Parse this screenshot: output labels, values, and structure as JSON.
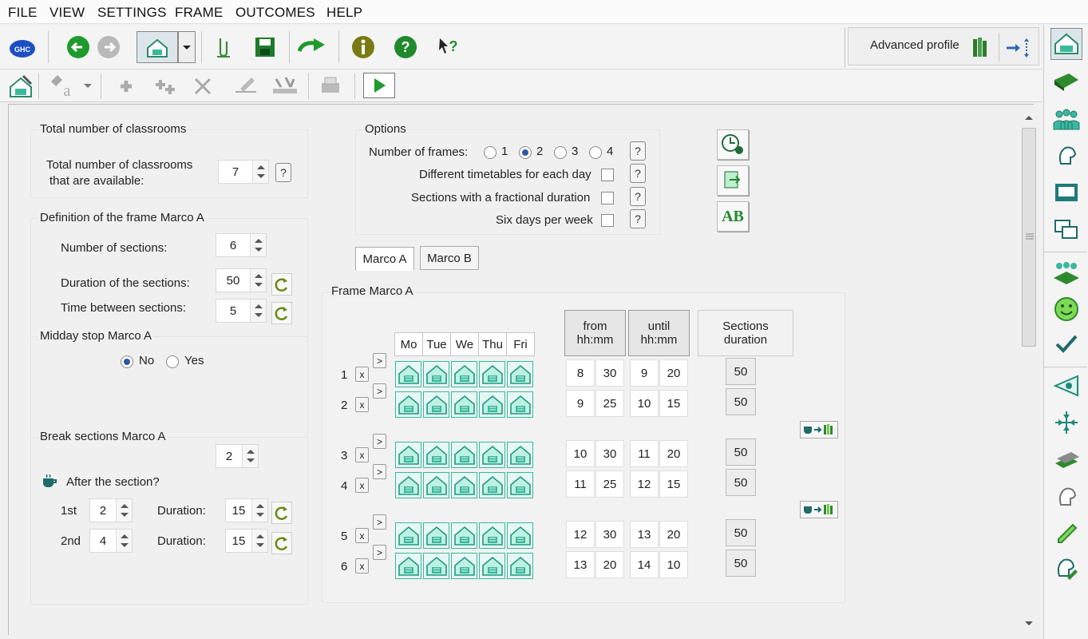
{
  "menu": [
    "FILE",
    "VIEW",
    "SETTINGS",
    "FRAME",
    "OUTCOMES",
    "HELP"
  ],
  "toolbar": {
    "ghc_label": "GHC",
    "profile_label": "Advanced profile"
  },
  "classrooms": {
    "title": "Total number of classrooms",
    "label_line1": "Total number of classrooms",
    "label_line2": "that are available:",
    "value": "7",
    "help": "?"
  },
  "frame_def": {
    "title": "Definition of the frame Marco A",
    "sections_label": "Number of sections:",
    "sections_value": "6",
    "duration_label": "Duration of the sections:",
    "duration_value": "50",
    "between_label": "Time between sections:",
    "between_value": "5"
  },
  "midday": {
    "title": "Midday stop Marco A",
    "no": "No",
    "yes": "Yes",
    "selected": "No"
  },
  "breaks": {
    "title": "Break sections Marco A",
    "count": "2",
    "after_label": "After the section?",
    "rows": [
      {
        "ord": "1st",
        "after": "2",
        "dur_label": "Duration:",
        "dur": "15"
      },
      {
        "ord": "2nd",
        "after": "4",
        "dur_label": "Duration:",
        "dur": "15"
      }
    ]
  },
  "options": {
    "title": "Options",
    "frames_label": "Number of frames:",
    "frames": [
      "1",
      "2",
      "3",
      "4"
    ],
    "frames_selected": "2",
    "diff_timetable": "Different timetables for each day",
    "fractional": "Sections with a fractional duration",
    "six_days": "Six days per week",
    "help": "?"
  },
  "ab_label": "AB",
  "tabs": [
    "Marco A",
    "Marco B"
  ],
  "frame": {
    "title": "Frame Marco A",
    "days": [
      "Mo",
      "Tue",
      "We",
      "Thu",
      "Fri"
    ],
    "from_header": "from",
    "until_header": "until",
    "time_format": "hh:mm",
    "dur_header_1": "Sections",
    "dur_header_2": "duration",
    "x_label": "x",
    "next_label": ">",
    "sections": [
      {
        "n": "1",
        "fh": "8",
        "fm": "30",
        "uh": "9",
        "um": "20",
        "dur": "50"
      },
      {
        "n": "2",
        "fh": "9",
        "fm": "25",
        "uh": "10",
        "um": "15",
        "dur": "50"
      },
      {
        "n": "3",
        "fh": "10",
        "fm": "30",
        "uh": "11",
        "um": "20",
        "dur": "50"
      },
      {
        "n": "4",
        "fh": "11",
        "fm": "25",
        "uh": "12",
        "um": "15",
        "dur": "50"
      },
      {
        "n": "5",
        "fh": "12",
        "fm": "30",
        "uh": "13",
        "um": "20",
        "dur": "50"
      },
      {
        "n": "6",
        "fh": "13",
        "fm": "20",
        "uh": "14",
        "um": "10",
        "dur": "50"
      }
    ]
  }
}
